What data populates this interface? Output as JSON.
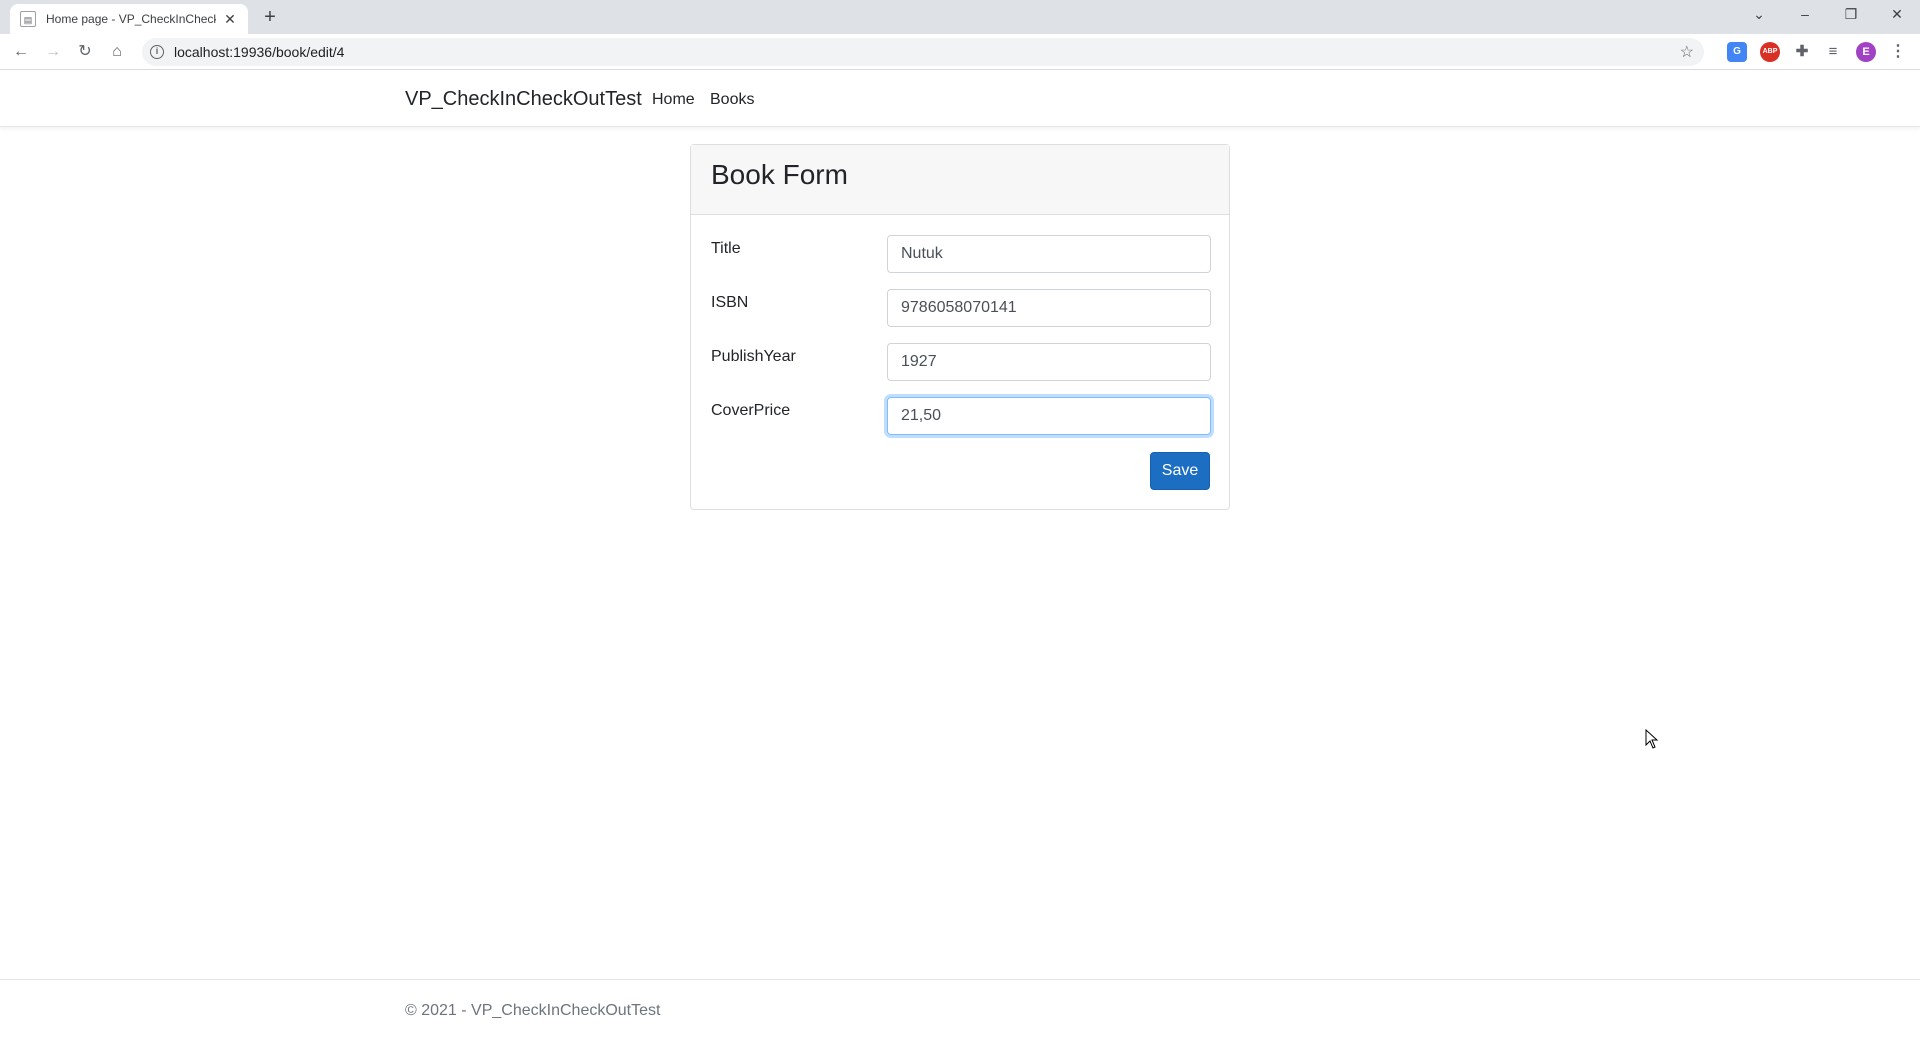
{
  "browser": {
    "tab_title": "Home page - VP_CheckInCheckO",
    "url": "localhost:19936/book/edit/4",
    "window_controls": {
      "chevron": "⌄",
      "minimize": "–",
      "maximize": "❐",
      "close": "✕"
    },
    "profile_initial": "E"
  },
  "nav": {
    "brand": "VP_CheckInCheckOutTest",
    "links": [
      "Home",
      "Books"
    ]
  },
  "form": {
    "heading": "Book Form",
    "fields": [
      {
        "label": "Title",
        "value": "Nutuk"
      },
      {
        "label": "ISBN",
        "value": "9786058070141"
      },
      {
        "label": "PublishYear",
        "value": "1927"
      },
      {
        "label": "CoverPrice",
        "value": "21,50"
      }
    ],
    "save_label": "Save"
  },
  "footer": {
    "text": "© 2021 - VP_CheckInCheckOutTest"
  },
  "colors": {
    "primary_button": "#1b6ec2",
    "focus_ring": "#80bdff"
  }
}
